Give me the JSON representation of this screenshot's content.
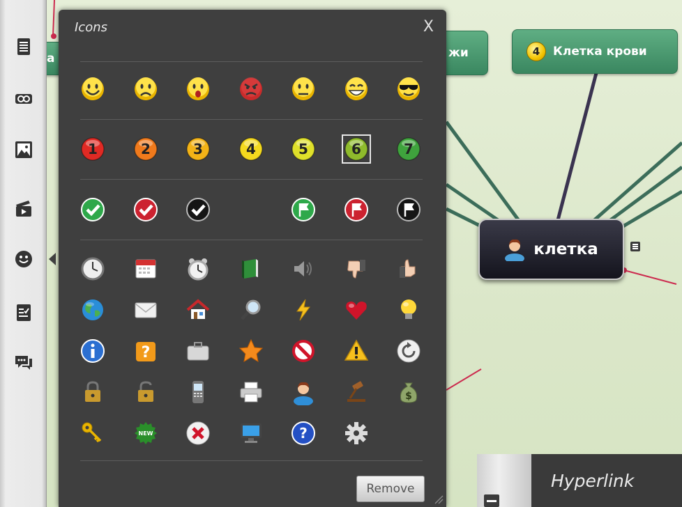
{
  "mindmap": {
    "node_partial_left": "а",
    "node_partial_mid": "жи",
    "node_blood_cell": {
      "number": "4",
      "label": "Клетка крови"
    },
    "central": {
      "label": "клетка"
    }
  },
  "toolbar": {
    "items": [
      {
        "name": "notes"
      },
      {
        "name": "link"
      },
      {
        "name": "image"
      },
      {
        "name": "video"
      },
      {
        "name": "icons"
      },
      {
        "name": "tasks"
      },
      {
        "name": "comments"
      }
    ]
  },
  "popup": {
    "title": "Icons",
    "close": "X",
    "remove": "Remove",
    "rows": [
      [
        "smiley-happy",
        "smiley-sad",
        "smiley-surprised",
        "smiley-angry",
        "smiley-neutral",
        "smiley-grin",
        "smiley-cool"
      ],
      [
        "1",
        "2",
        "3",
        "4",
        "5",
        "6",
        "7"
      ],
      [
        "check-green",
        "check-red",
        "check-black",
        "",
        "flag-green",
        "flag-red",
        "flag-black"
      ],
      [
        "clock",
        "calendar",
        "alarm-clock",
        "book",
        "speaker",
        "thumbs-down",
        "thumbs-up"
      ],
      [
        "globe",
        "envelope",
        "house",
        "magnifier",
        "lightning",
        "heart",
        "lightbulb"
      ],
      [
        "info",
        "question-box",
        "briefcase",
        "star",
        "no-entry",
        "warning",
        "refresh"
      ],
      [
        "lock-closed",
        "lock-open",
        "mobile-phone",
        "printer",
        "person",
        "gavel",
        "money-bag"
      ],
      [
        "key",
        "new-badge",
        "cancel",
        "monitor",
        "help",
        "gear",
        ""
      ]
    ],
    "number_colors": [
      "#e02a24",
      "#f07a1c",
      "#f3b317",
      "#f4d91e",
      "#dfe02a",
      "#8fbb2c",
      "#3fa33d"
    ],
    "selected": "6"
  },
  "hyperlink": {
    "title": "Hyperlink"
  }
}
